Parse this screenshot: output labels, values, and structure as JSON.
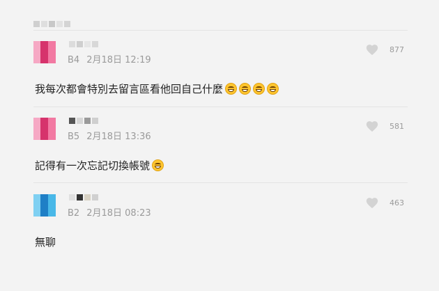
{
  "comments": [
    {
      "floor": "B4",
      "date": "2月18日 12:19",
      "likes": "877",
      "text": "我每次都會特別去留言區看他回自己什麼",
      "emoji_count": 4,
      "avatar_colors": [
        "#f6a8c4",
        "#d6336c",
        "#f279a2"
      ],
      "name_colors": [
        "#dcdcdc",
        "#cfcfcf",
        "#e6e6e6",
        "#d8d8d8"
      ]
    },
    {
      "floor": "B5",
      "date": "2月18日 13:36",
      "likes": "581",
      "text": "記得有一次忘記切換帳號",
      "emoji_count": 1,
      "avatar_colors": [
        "#f6a8c4",
        "#d6336c",
        "#f279a2"
      ],
      "name_colors": [
        "#555555",
        "#d6d6d6",
        "#9a9a9a",
        "#cfcfcf"
      ]
    },
    {
      "floor": "B2",
      "date": "2月18日 08:23",
      "likes": "463",
      "text": "無聊",
      "emoji_count": 0,
      "avatar_colors": [
        "#49b8e8",
        "#1f7fc6",
        "#7fd0f2"
      ],
      "name_colors": [
        "#e0e0e0",
        "#333333",
        "#d8d2c4",
        "#d0d0d0"
      ]
    }
  ]
}
